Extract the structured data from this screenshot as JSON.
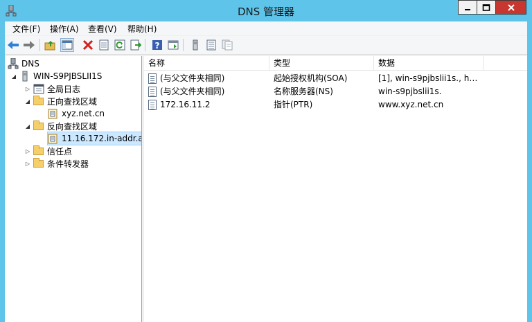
{
  "window": {
    "title": "DNS 管理器"
  },
  "menu": [
    {
      "label": "文件(F)"
    },
    {
      "label": "操作(A)"
    },
    {
      "label": "查看(V)"
    },
    {
      "label": "帮助(H)"
    }
  ],
  "tree": {
    "root": "DNS",
    "server": "WIN-S9PJBSLII1S",
    "global_log": "全局日志",
    "forward_zones": "正向查找区域",
    "forward_zone_item": "xyz.net.cn",
    "reverse_zones": "反向查找区域",
    "reverse_zone_item": "11.16.172.in-addr.a",
    "trust_points": "信任点",
    "conditional_forwarders": "条件转发器"
  },
  "list": {
    "columns": [
      "名称",
      "类型",
      "数据"
    ],
    "rows": [
      {
        "name": "(与父文件夹相同)",
        "type": "起始授权机构(SOA)",
        "data": "[1], win-s9pjbslii1s., hos..."
      },
      {
        "name": "(与父文件夹相同)",
        "type": "名称服务器(NS)",
        "data": "win-s9pjbslii1s."
      },
      {
        "name": "172.16.11.2",
        "type": "指针(PTR)",
        "data": "www.xyz.net.cn"
      }
    ]
  },
  "colors": {
    "titlebar": "#5ec4ea",
    "close_button": "#c7372f",
    "selection": "#cce8ff"
  }
}
